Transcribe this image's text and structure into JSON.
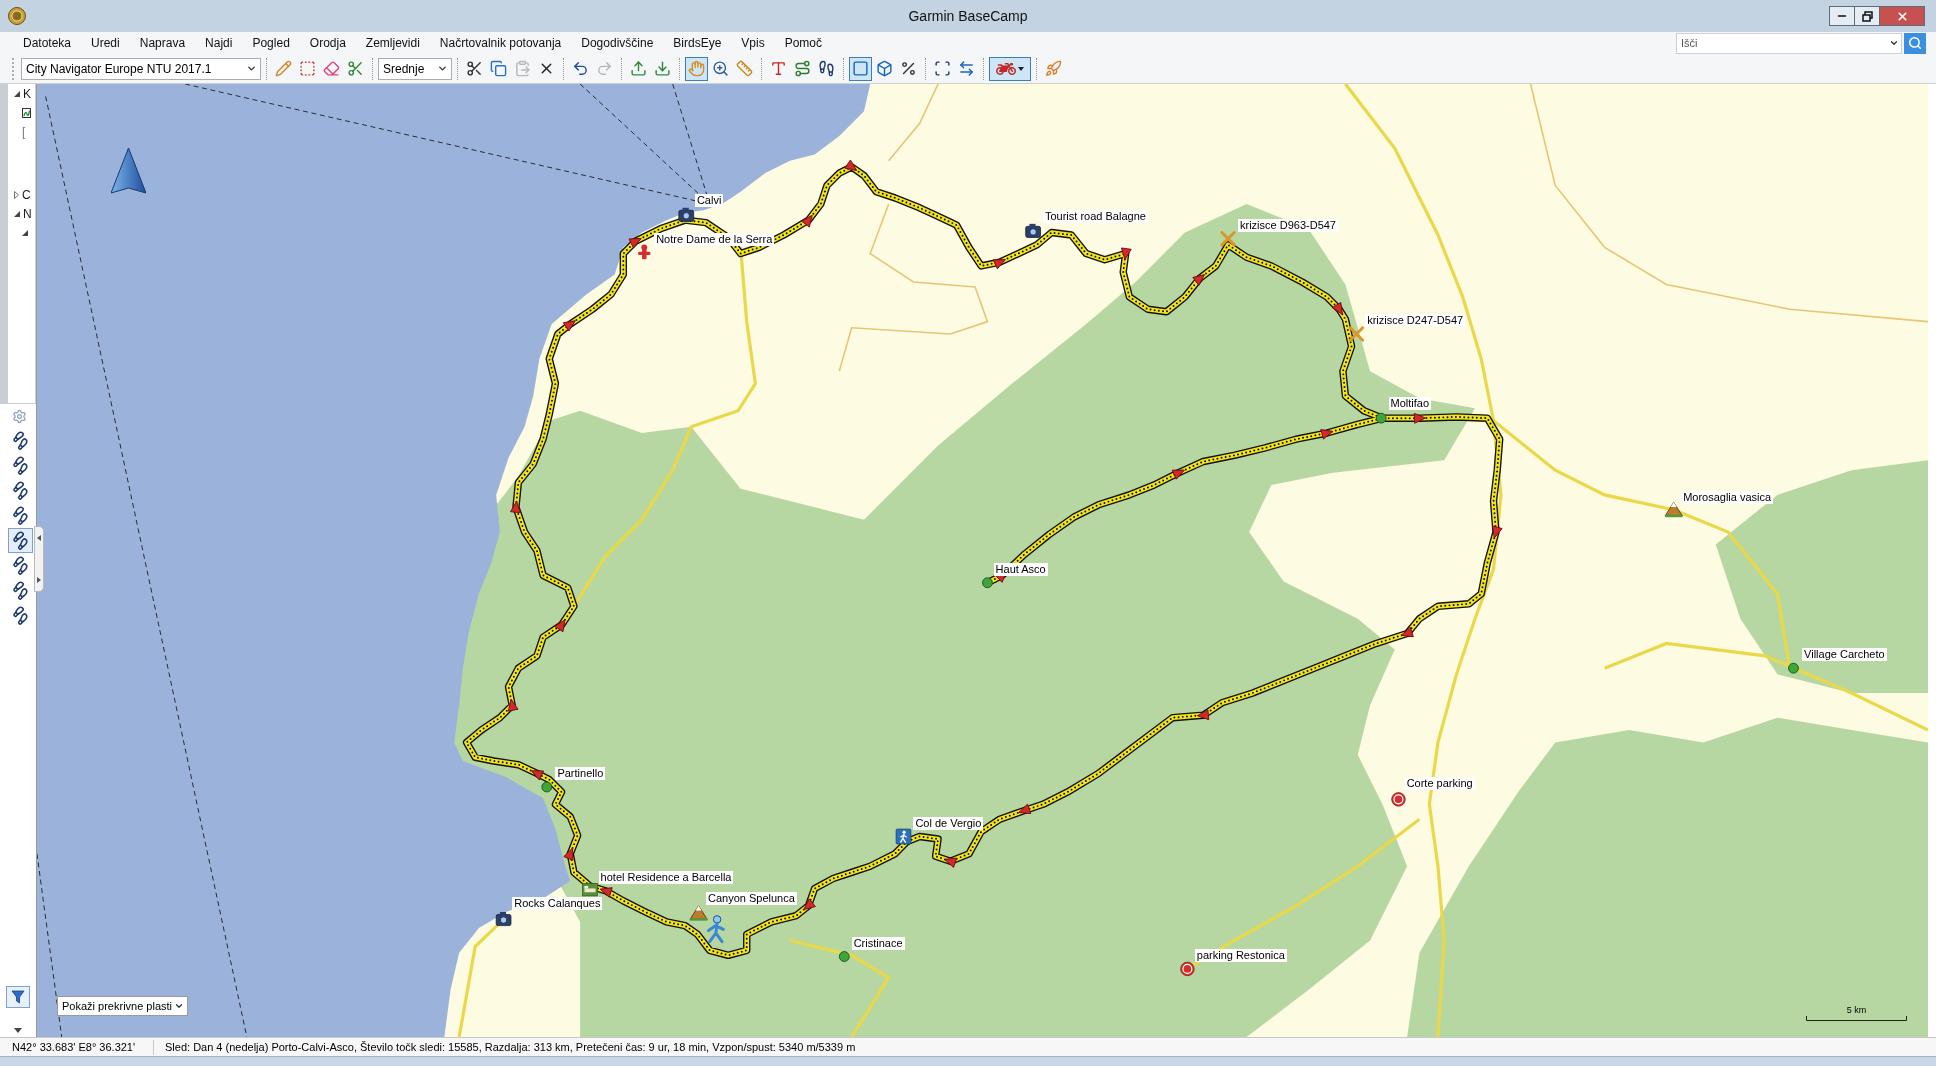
{
  "window": {
    "title": "Garmin BaseCamp"
  },
  "menu": [
    "Datoteka",
    "Uredi",
    "Naprava",
    "Najdi",
    "Pogled",
    "Orodja",
    "Zemljevidi",
    "Načrtovalnik potovanja",
    "Dogodivščine",
    "BirdsEye",
    "Vpis",
    "Pomoč"
  ],
  "search": {
    "placeholder": "Išči"
  },
  "toolbar": {
    "map_product": "City Navigator Europe NTU 2017.1",
    "detail_level": "Srednje",
    "tools": [
      {
        "selected": false,
        "disabled": false
      },
      {
        "selected": false,
        "disabled": false
      },
      {
        "selected": false,
        "disabled": false
      },
      {
        "selected": false,
        "disabled": false
      },
      {
        "selected": false,
        "disabled": false
      },
      {
        "selected": false,
        "disabled": false
      },
      {
        "selected": false,
        "disabled": true
      },
      {
        "selected": false,
        "disabled": false
      },
      {
        "selected": false,
        "disabled": false
      },
      {
        "selected": false,
        "disabled": true
      },
      {
        "selected": false,
        "disabled": false
      },
      {
        "selected": false,
        "disabled": false
      },
      {
        "selected": true,
        "disabled": false
      },
      {
        "selected": false,
        "disabled": false
      },
      {
        "selected": false,
        "disabled": false
      },
      {
        "selected": false,
        "disabled": false
      },
      {
        "selected": false,
        "disabled": false
      },
      {
        "selected": false,
        "disabled": false
      },
      {
        "selected": true,
        "disabled": false
      },
      {
        "selected": false,
        "disabled": false
      },
      {
        "selected": false,
        "disabled": false
      },
      {
        "selected": false,
        "disabled": false
      },
      {
        "selected": false,
        "disabled": false
      },
      {
        "selected": false,
        "disabled": false
      }
    ],
    "profile": {
      "selected": true
    }
  },
  "sidebar": {
    "tree": [
      {
        "label": "K",
        "expanded": true,
        "children": [
          {
            "kind": "track"
          },
          {
            "kind": "text",
            "label": "["
          }
        ]
      },
      {
        "label": "C",
        "expanded": false
      },
      {
        "label": "N",
        "expanded": true,
        "children": [
          {
            "kind": "folder",
            "expanded": true
          }
        ]
      }
    ],
    "tracks": [
      {
        "selected": false
      },
      {
        "selected": false
      },
      {
        "selected": false
      },
      {
        "selected": false
      },
      {
        "selected": true
      },
      {
        "selected": false
      },
      {
        "selected": false
      },
      {
        "selected": false
      }
    ]
  },
  "map": {
    "waypoints": [
      {
        "label": "Calvi",
        "kind": "camera"
      },
      {
        "label": "Tourist road Balagne",
        "kind": "camera"
      },
      {
        "label": "krizisce D963-D547",
        "kind": "junction"
      },
      {
        "label": "Notre Dame de la Serra",
        "kind": "marker"
      },
      {
        "label": "krizisce D247-D547",
        "kind": "junction"
      },
      {
        "label": "Moltifao",
        "kind": "dot"
      },
      {
        "label": "Morosaglia vasica",
        "kind": "mountain"
      },
      {
        "label": "Haut Asco",
        "kind": "dot"
      },
      {
        "label": "Village Carcheto",
        "kind": "dot"
      },
      {
        "label": "Partinello",
        "kind": "dot"
      },
      {
        "label": "Corte parking",
        "kind": "parking"
      },
      {
        "label": "Col de Vergio",
        "kind": "hiker"
      },
      {
        "label": "hotel Residence a Barcella",
        "kind": "hotel"
      },
      {
        "label": "Canyon Spelunca",
        "kind": "mountain"
      },
      {
        "label": "Rocks Calanques",
        "kind": "camera"
      },
      {
        "label": "Cristinace",
        "kind": "dot"
      },
      {
        "label": "parking Restonica",
        "kind": "parking"
      }
    ],
    "overlay_select": "Pokaži prekrivne plasti",
    "scale": "5 km"
  },
  "status_bar": {
    "coordinates": "N42° 33.683' E8° 36.321'",
    "track_info": "Sled: Dan 4 (nedelja) Porto-Calvi-Asco, Število točk sledi: 15585, Razdalja: 313 km, Pretečeni čas: 9 ur, 18 min, Vzpon/spust: 5340 m/5339 m"
  }
}
